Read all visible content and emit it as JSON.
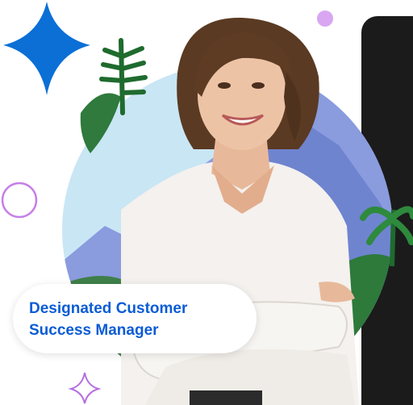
{
  "badge": {
    "line1": "Designated Customer",
    "line2": "Success Manager"
  },
  "colors": {
    "accent_blue": "#0b5cd5",
    "star_blue": "#0b6fd6",
    "lavender": "#d9a6f2",
    "sky": "#bfe0f2",
    "mountain": "#7f93d8",
    "foliage": "#2e7d3a",
    "dark_panel": "#1b1b1b"
  },
  "icons": [
    "four-point-star-icon",
    "circle-outline-icon",
    "dot-icon",
    "sparkle-outline-icon"
  ]
}
